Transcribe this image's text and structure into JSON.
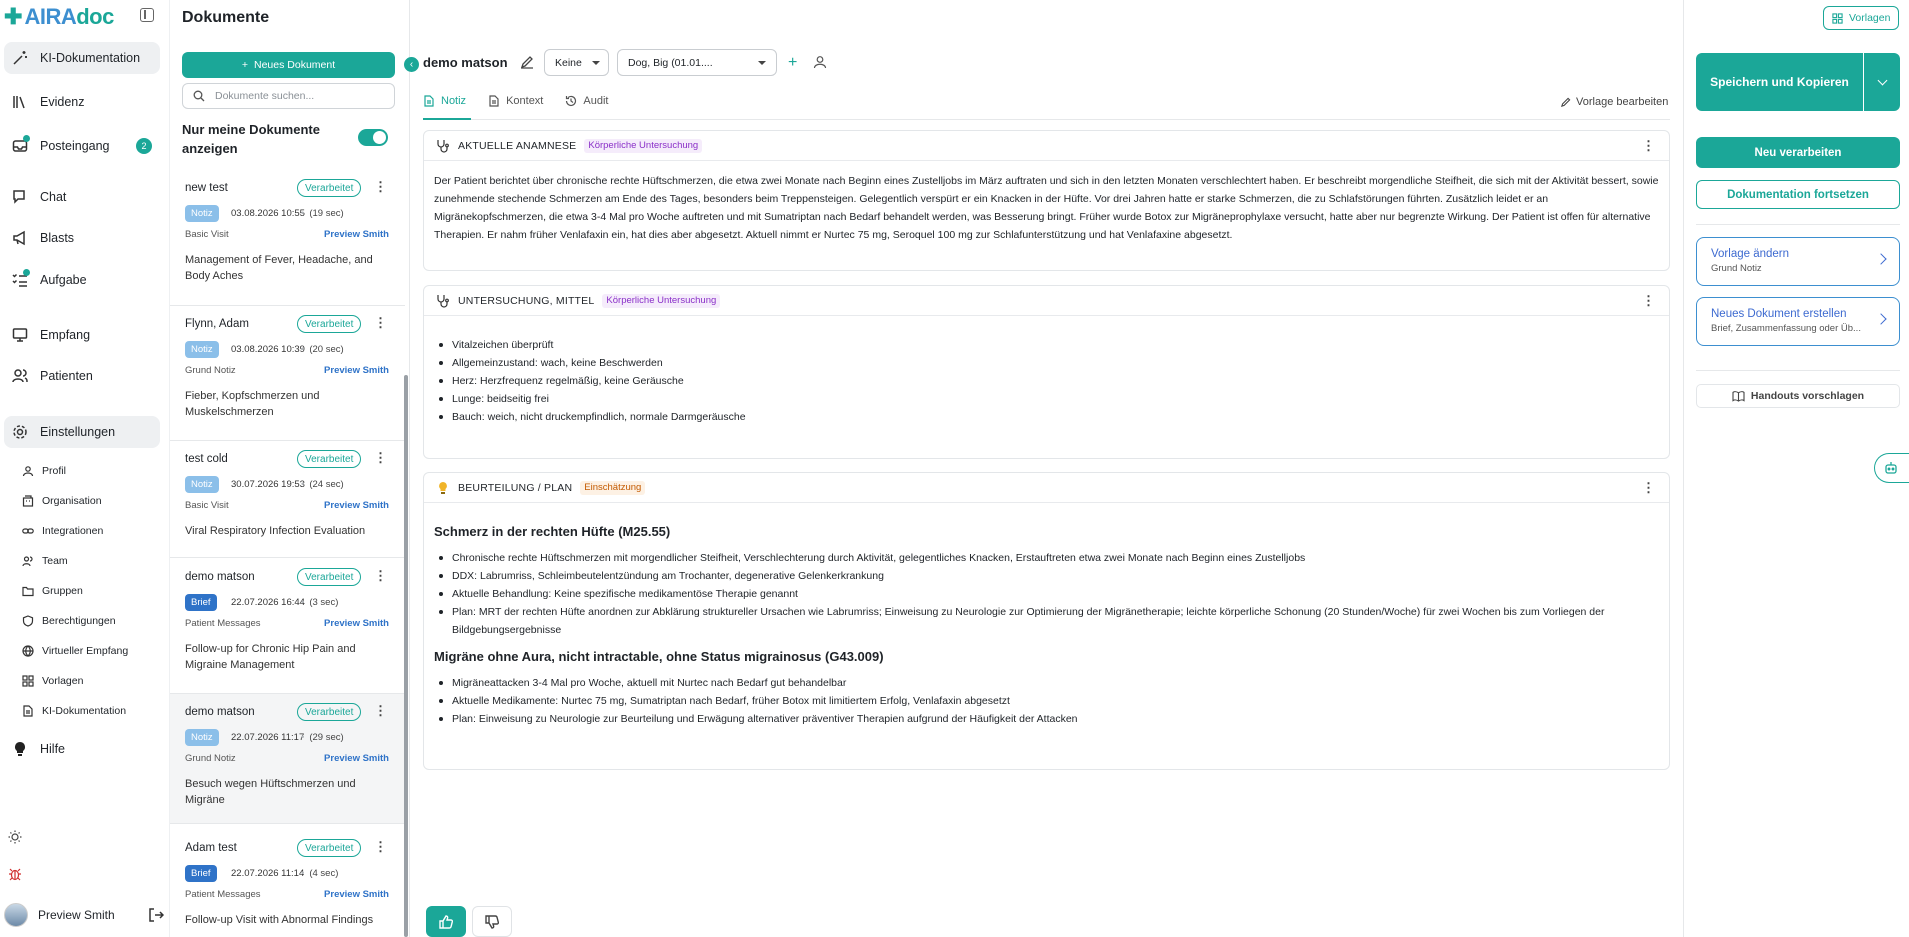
{
  "app": {
    "logo_mark": "✚",
    "logo_text_1": "AIRA",
    "logo_text_2": "doc",
    "page_title": "Dokumente",
    "brand_color": "#1ba798",
    "link_color": "#2f73c8"
  },
  "nav": {
    "items": [
      {
        "label": "KI-Dokumentation",
        "icon": "magic-wand-icon"
      },
      {
        "label": "Evidenz",
        "icon": "library-icon"
      },
      {
        "label": "Posteingang",
        "icon": "inbox-icon",
        "badge": "2"
      },
      {
        "label": "Chat",
        "icon": "chat-icon"
      },
      {
        "label": "Blasts",
        "icon": "megaphone-icon"
      },
      {
        "label": "Aufgabe",
        "icon": "tasks-icon"
      },
      {
        "label": "Empfang",
        "icon": "monitor-icon"
      },
      {
        "label": "Patienten",
        "icon": "users-icon"
      },
      {
        "label": "Einstellungen",
        "icon": "gear-icon"
      }
    ],
    "settings_sub": [
      {
        "label": "Profil",
        "icon": "user-icon"
      },
      {
        "label": "Organisation",
        "icon": "building-icon"
      },
      {
        "label": "Integrationen",
        "icon": "link-icon"
      },
      {
        "label": "Team",
        "icon": "team-icon"
      },
      {
        "label": "Gruppen",
        "icon": "folder-icon"
      },
      {
        "label": "Berechtigungen",
        "icon": "shield-icon"
      },
      {
        "label": "Virtueller Empfang",
        "icon": "globe-icon"
      },
      {
        "label": "Vorlagen",
        "icon": "grid-icon"
      },
      {
        "label": "KI-Dokumentation",
        "icon": "document-icon"
      }
    ],
    "help_label": "Hilfe",
    "user_name": "Preview Smith"
  },
  "docs": {
    "new_button": "Neues Dokument",
    "search_placeholder": "Dokumente suchen...",
    "only_mine_label": "Nur meine Dokumente anzeigen",
    "cards": [
      {
        "name": "new test",
        "status": "Verarbeitet",
        "tag": "Notiz",
        "date": "03.08.2026 10:55",
        "duration": "(19 sec)",
        "template": "Basic Visit",
        "author": "Preview Smith",
        "summary": "Management of Fever, Headache, and Body Aches"
      },
      {
        "name": "Flynn, Adam",
        "status": "Verarbeitet",
        "tag": "Notiz",
        "date": "03.08.2026 10:39",
        "duration": "(20 sec)",
        "template": "Grund Notiz",
        "author": "Preview Smith",
        "summary": "Fieber, Kopfschmerzen und Muskelschmerzen"
      },
      {
        "name": "test cold",
        "status": "Verarbeitet",
        "tag": "Notiz",
        "date": "30.07.2026 19:53",
        "duration": "(24 sec)",
        "template": "Basic Visit",
        "author": "Preview Smith",
        "summary": "Viral Respiratory Infection Evaluation"
      },
      {
        "name": "demo matson",
        "status": "Verarbeitet",
        "tag": "Brief",
        "date": "22.07.2026 16:44",
        "duration": "(3 sec)",
        "template": "Patient Messages",
        "author": "Preview Smith",
        "summary": "Follow-up for Chronic Hip Pain and Migraine Management"
      },
      {
        "name": "demo matson",
        "status": "Verarbeitet",
        "tag": "Notiz",
        "date": "22.07.2026 11:17",
        "duration": "(29 sec)",
        "template": "Grund Notiz",
        "author": "Preview Smith",
        "summary": "Besuch wegen Hüftschmerzen und Migräne"
      },
      {
        "name": "Adam test",
        "status": "Verarbeitet",
        "tag": "Brief",
        "date": "22.07.2026 11:14",
        "duration": "(4 sec)",
        "template": "Patient Messages",
        "author": "Preview Smith",
        "summary": "Follow-up Visit with Abnormal Findings"
      }
    ]
  },
  "main": {
    "patient_name": "demo matson",
    "select_1": "Keine",
    "select_2": "Dog, Big (01.01....",
    "tabs": [
      "Notiz",
      "Kontext",
      "Audit"
    ],
    "edit_template": "Vorlage bearbeiten",
    "sections": {
      "anamnese": {
        "title": "AKTUELLE ANAMNESE",
        "badge": "Körperliche Untersuchung",
        "text": "Der Patient berichtet über chronische rechte Hüftschmerzen, die etwa zwei Monate nach Beginn eines Zustelljobs im März auftraten und sich in den letzten Monaten verschlechtert haben. Er beschreibt morgendliche Steifheit, die sich mit der Aktivität bessert, sowie zunehmende stechende Schmerzen am Ende des Tages, besonders beim Treppensteigen. Gelegentlich verspürt er ein Knacken in der Hüfte. Vor drei Jahren hatte er starke Schmerzen, die zu Schlafstörungen führten. Zusätzlich leidet er an Migränekopfschmerzen, die etwa 3-4 Mal pro Woche auftreten und mit Sumatriptan nach Bedarf behandelt werden, was Besserung bringt. Früher wurde Botox zur Migräneprophylaxe versucht, hatte aber nur begrenzte Wirkung. Der Patient ist offen für alternative Therapien. Er nahm früher Venlafaxin ein, hat dies aber abgesetzt. Aktuell nimmt er Nurtec 75 mg, Seroquel 100 mg zur Schlafunterstützung und hat Venlafaxine abgesetzt."
      },
      "untersuchung": {
        "title": "UNTERSUCHUNG, MITTEL",
        "badge": "Körperliche Untersuchung",
        "items": [
          "Vitalzeichen überprüft",
          "Allgemeinzustand: wach, keine Beschwerden",
          "Herz: Herzfrequenz regelmäßig, keine Geräusche",
          "Lunge: beidseitig frei",
          "Bauch: weich, nicht druckempfindlich, normale Darmgeräusche"
        ]
      },
      "plan": {
        "title": "BEURTEILUNG / PLAN",
        "badge": "Einschätzung",
        "diagnoses": [
          {
            "title": "Schmerz in der rechten Hüfte (M25.55)",
            "items": [
              "Chronische rechte Hüftschmerzen mit morgendlicher Steifheit, Verschlechterung durch Aktivität, gelegentliches Knacken, Erstauftreten etwa zwei Monate nach Beginn eines Zustelljobs",
              "DDX: Labrumriss, Schleimbeutelentzündung am Trochanter, degenerative Gelenkerkrankung",
              "Aktuelle Behandlung: Keine spezifische medikamentöse Therapie genannt",
              "Plan: MRT der rechten Hüfte anordnen zur Abklärung struktureller Ursachen wie Labrumriss; Einweisung zu Neurologie zur Optimierung der Migränetherapie; leichte körperliche Schonung (20 Stunden/Woche) für zwei Wochen bis zum Vorliegen der Bildgebungsergebnisse"
            ]
          },
          {
            "title": "Migräne ohne Aura, nicht intractable, ohne Status migrainosus (G43.009)",
            "items": [
              "Migräneattacken 3-4 Mal pro Woche, aktuell mit Nurtec nach Bedarf gut behandelbar",
              "Aktuelle Medikamente: Nurtec 75 mg, Sumatriptan nach Bedarf, früher Botox mit limitiertem Erfolg, Venlafaxin abgesetzt",
              "Plan: Einweisung zu Neurologie zur Beurteilung und Erwägung alternativer präventiver Therapien aufgrund der Häufigkeit der Attacken"
            ]
          }
        ]
      }
    }
  },
  "right": {
    "vorlagen": "Vorlagen",
    "save_copy": "Speichern und Kopieren",
    "reprocess": "Neu verarbeiten",
    "continue_doc": "Dokumentation fortsetzen",
    "change_template_title": "Vorlage ändern",
    "change_template_sub": "Grund Notiz",
    "new_doc_title": "Neues Dokument erstellen",
    "new_doc_sub": "Brief, Zusammenfassung oder Üb...",
    "handouts": "Handouts vorschlagen"
  }
}
